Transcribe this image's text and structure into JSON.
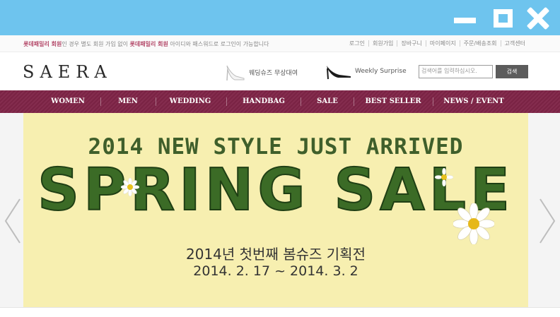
{
  "window": {
    "controls": [
      "minimize-icon",
      "maximize-icon",
      "close-icon"
    ],
    "bar_color": "#6ec4ee"
  },
  "util": {
    "notice_pre_hl": "롯데패밀리 회원",
    "notice_mid": "인 경우 별도 회원 가입 없이 ",
    "notice_hl2": "롯데패밀리 회원",
    "notice_post": " 아이디와 패스워드로 로그인이 가능합니다",
    "links": [
      "로그인",
      "회원가입",
      "장바구니",
      "마이페이지",
      "주문/배송조회",
      "고객센터"
    ]
  },
  "header": {
    "logo": "SAERA",
    "promo_wedding": "웨딩슈즈 무상대여",
    "promo_weekly": "Weekly Surprise",
    "search_placeholder": "검색어를 입력하십시오.",
    "search_button": "검색"
  },
  "nav": {
    "items": [
      "WOMEN",
      "MEN",
      "WEDDING",
      "HANDBAG",
      "SALE",
      "BEST SELLER",
      "NEWS / EVENT"
    ],
    "color": "#7f2447"
  },
  "banner": {
    "headline": "2014 NEW STYLE JUST ARRIVED",
    "sale": "SPRING SALE",
    "subtitle": "2014년 첫번째 봄슈즈 기획전",
    "dates": "2014. 2. 17 ~ 2014. 3. 2",
    "background": "#f7efb0"
  },
  "carousel": {
    "prev_icon": "chevron-left-icon",
    "next_icon": "chevron-right-icon"
  }
}
